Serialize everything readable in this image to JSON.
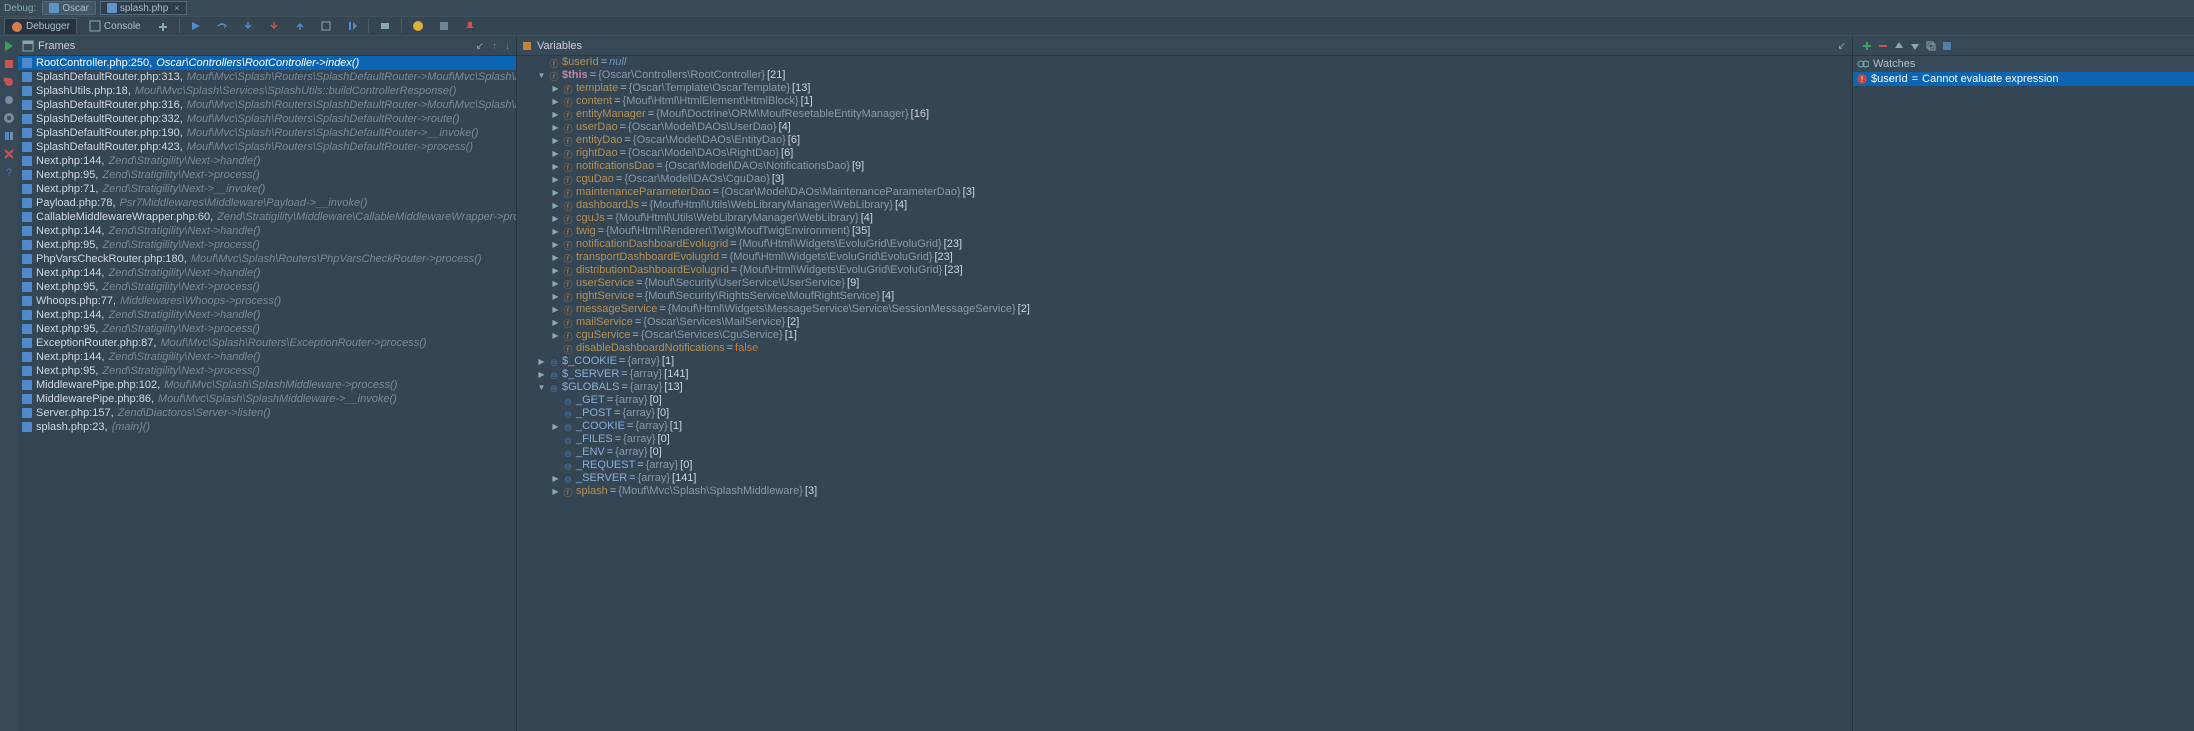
{
  "topbar": {
    "label": "Debug:",
    "tabs": [
      {
        "name": "Oscar",
        "active": false
      },
      {
        "name": "splash.php",
        "active": true
      }
    ]
  },
  "toolbar": {
    "debugger": "Debugger",
    "console": "Console"
  },
  "panels": {
    "frames": "Frames",
    "variables": "Variables",
    "watches": "Watches"
  },
  "frames": [
    {
      "loc": "RootController.php:250",
      "fn": "Oscar\\Controllers\\RootController->index()",
      "sel": true
    },
    {
      "loc": "SplashDefaultRouter.php:313",
      "fn": "Mouf\\Mvc\\Splash\\Routers\\SplashDefaultRouter->Mouf\\Mvc\\Splash\\Routers\\{closure:/var/www/...}"
    },
    {
      "loc": "SplashUtils.php:18",
      "fn": "Mouf\\Mvc\\Splash\\Services\\SplashUtils::buildControllerResponse()"
    },
    {
      "loc": "SplashDefaultRouter.php:316",
      "fn": "Mouf\\Mvc\\Splash\\Routers\\SplashDefaultRouter->Mouf\\Mvc\\Splash\\Routers\\{closure:/var/www/...}()"
    },
    {
      "loc": "SplashDefaultRouter.php:332",
      "fn": "Mouf\\Mvc\\Splash\\Routers\\SplashDefaultRouter->route()"
    },
    {
      "loc": "SplashDefaultRouter.php:190",
      "fn": "Mouf\\Mvc\\Splash\\Routers\\SplashDefaultRouter->__invoke()"
    },
    {
      "loc": "SplashDefaultRouter.php:423",
      "fn": "Mouf\\Mvc\\Splash\\Routers\\SplashDefaultRouter->process()"
    },
    {
      "loc": "Next.php:144",
      "fn": "Zend\\Stratigility\\Next->handle()"
    },
    {
      "loc": "Next.php:95",
      "fn": "Zend\\Stratigility\\Next->process()"
    },
    {
      "loc": "Next.php:71",
      "fn": "Zend\\Stratigility\\Next->__invoke()"
    },
    {
      "loc": "Payload.php:78",
      "fn": "Psr7Middlewares\\Middleware\\Payload->__invoke()"
    },
    {
      "loc": "CallableMiddlewareWrapper.php:60",
      "fn": "Zend\\Stratigility\\Middleware\\CallableMiddlewareWrapper->process()"
    },
    {
      "loc": "Next.php:144",
      "fn": "Zend\\Stratigility\\Next->handle()"
    },
    {
      "loc": "Next.php:95",
      "fn": "Zend\\Stratigility\\Next->process()"
    },
    {
      "loc": "PhpVarsCheckRouter.php:180",
      "fn": "Mouf\\Mvc\\Splash\\Routers\\PhpVarsCheckRouter->process()"
    },
    {
      "loc": "Next.php:144",
      "fn": "Zend\\Stratigility\\Next->handle()"
    },
    {
      "loc": "Next.php:95",
      "fn": "Zend\\Stratigility\\Next->process()"
    },
    {
      "loc": "Whoops.php:77",
      "fn": "Middlewares\\Whoops->process()"
    },
    {
      "loc": "Next.php:144",
      "fn": "Zend\\Stratigility\\Next->handle()"
    },
    {
      "loc": "Next.php:95",
      "fn": "Zend\\Stratigility\\Next->process()"
    },
    {
      "loc": "ExceptionRouter.php:87",
      "fn": "Mouf\\Mvc\\Splash\\Routers\\ExceptionRouter->process()"
    },
    {
      "loc": "Next.php:144",
      "fn": "Zend\\Stratigility\\Next->handle()"
    },
    {
      "loc": "Next.php:95",
      "fn": "Zend\\Stratigility\\Next->process()"
    },
    {
      "loc": "MiddlewarePipe.php:102",
      "fn": "Mouf\\Mvc\\Splash\\SplashMiddleware->process()"
    },
    {
      "loc": "MiddlewarePipe.php:86",
      "fn": "Mouf\\Mvc\\Splash\\SplashMiddleware->__invoke()"
    },
    {
      "loc": "Server.php:157",
      "fn": "Zend\\Diactoros\\Server->listen()"
    },
    {
      "loc": "splash.php:23",
      "fn": "{main}()"
    }
  ],
  "vars": [
    {
      "d": 0,
      "tw": "",
      "ico": "f",
      "name": "$userId",
      "eq": "=",
      "type": "",
      "val": "null",
      "valcls": "vlit",
      "ncls": "vname"
    },
    {
      "d": 0,
      "tw": "▼",
      "ico": "f",
      "name": "$this",
      "eq": "=",
      "type": "{Oscar\\Controllers\\RootController}",
      "val": "[21]",
      "ncls": "vnamebold"
    },
    {
      "d": 1,
      "tw": "▶",
      "ico": "f",
      "name": "template",
      "eq": "=",
      "type": "{Oscar\\Template\\OscarTemplate}",
      "val": "[13]",
      "ncls": "vname"
    },
    {
      "d": 1,
      "tw": "▶",
      "ico": "f",
      "name": "content",
      "eq": "=",
      "type": "{Mouf\\Html\\HtmlElement\\HtmlBlock}",
      "val": "[1]",
      "ncls": "vname"
    },
    {
      "d": 1,
      "tw": "▶",
      "ico": "f",
      "name": "entityManager",
      "eq": "=",
      "type": "{Mouf\\Doctrine\\ORM\\MoufResetableEntityManager}",
      "val": "[16]",
      "ncls": "vname"
    },
    {
      "d": 1,
      "tw": "▶",
      "ico": "f",
      "name": "userDao",
      "eq": "=",
      "type": "{Oscar\\Model\\DAOs\\UserDao}",
      "val": "[4]",
      "ncls": "vname"
    },
    {
      "d": 1,
      "tw": "▶",
      "ico": "f",
      "name": "entityDao",
      "eq": "=",
      "type": "{Oscar\\Model\\DAOs\\EntityDao}",
      "val": "[6]",
      "ncls": "vname"
    },
    {
      "d": 1,
      "tw": "▶",
      "ico": "f",
      "name": "rightDao",
      "eq": "=",
      "type": "{Oscar\\Model\\DAOs\\RightDao}",
      "val": "[6]",
      "ncls": "vname"
    },
    {
      "d": 1,
      "tw": "▶",
      "ico": "f",
      "name": "notificationsDao",
      "eq": "=",
      "type": "{Oscar\\Model\\DAOs\\NotificationsDao}",
      "val": "[9]",
      "ncls": "vname"
    },
    {
      "d": 1,
      "tw": "▶",
      "ico": "f",
      "name": "cguDao",
      "eq": "=",
      "type": "{Oscar\\Model\\DAOs\\CguDao}",
      "val": "[3]",
      "ncls": "vname"
    },
    {
      "d": 1,
      "tw": "▶",
      "ico": "f",
      "name": "maintenanceParameterDao",
      "eq": "=",
      "type": "{Oscar\\Model\\DAOs\\MaintenanceParameterDao}",
      "val": "[3]",
      "ncls": "vname"
    },
    {
      "d": 1,
      "tw": "▶",
      "ico": "f",
      "name": "dashboardJs",
      "eq": "=",
      "type": "{Mouf\\Html\\Utils\\WebLibraryManager\\WebLibrary}",
      "val": "[4]",
      "ncls": "vname"
    },
    {
      "d": 1,
      "tw": "▶",
      "ico": "f",
      "name": "cguJs",
      "eq": "=",
      "type": "{Mouf\\Html\\Utils\\WebLibraryManager\\WebLibrary}",
      "val": "[4]",
      "ncls": "vname"
    },
    {
      "d": 1,
      "tw": "▶",
      "ico": "f",
      "name": "twig",
      "eq": "=",
      "type": "{Mouf\\Html\\Renderer\\Twig\\MoufTwigEnvironment}",
      "val": "[35]",
      "ncls": "vname"
    },
    {
      "d": 1,
      "tw": "▶",
      "ico": "f",
      "name": "notificationDashboardEvolugrid",
      "eq": "=",
      "type": "{Mouf\\Html\\Widgets\\EvoluGrid\\EvoluGrid}",
      "val": "[23]",
      "ncls": "vname"
    },
    {
      "d": 1,
      "tw": "▶",
      "ico": "f",
      "name": "transportDashboardEvolugrid",
      "eq": "=",
      "type": "{Mouf\\Html\\Widgets\\EvoluGrid\\EvoluGrid}",
      "val": "[23]",
      "ncls": "vname"
    },
    {
      "d": 1,
      "tw": "▶",
      "ico": "f",
      "name": "distributionDashboardEvolugrid",
      "eq": "=",
      "type": "{Mouf\\Html\\Widgets\\EvoluGrid\\EvoluGrid}",
      "val": "[23]",
      "ncls": "vname"
    },
    {
      "d": 1,
      "tw": "▶",
      "ico": "f",
      "name": "userService",
      "eq": "=",
      "type": "{Mouf\\Security\\UserService\\UserService}",
      "val": "[9]",
      "ncls": "vname"
    },
    {
      "d": 1,
      "tw": "▶",
      "ico": "f",
      "name": "rightService",
      "eq": "=",
      "type": "{Mouf\\Security\\RightsService\\MoufRightService}",
      "val": "[4]",
      "ncls": "vname"
    },
    {
      "d": 1,
      "tw": "▶",
      "ico": "f",
      "name": "messageService",
      "eq": "=",
      "type": "{Mouf\\Html\\Widgets\\MessageService\\Service\\SessionMessageService}",
      "val": "[2]",
      "ncls": "vname"
    },
    {
      "d": 1,
      "tw": "▶",
      "ico": "f",
      "name": "mailService",
      "eq": "=",
      "type": "{Oscar\\Services\\MailService}",
      "val": "[2]",
      "ncls": "vname"
    },
    {
      "d": 1,
      "tw": "▶",
      "ico": "f",
      "name": "cguService",
      "eq": "=",
      "type": "{Oscar\\Services\\CguService}",
      "val": "[1]",
      "ncls": "vname"
    },
    {
      "d": 1,
      "tw": "",
      "ico": "f",
      "name": "disableDashboardNotifications",
      "eq": "=",
      "type": "",
      "val": "false",
      "valcls": "vfalse",
      "ncls": "vname"
    },
    {
      "d": 0,
      "tw": "▶",
      "ico": "g",
      "name": "$_COOKIE",
      "eq": "=",
      "type": "{array}",
      "val": "[1]",
      "ncls": "vname blue"
    },
    {
      "d": 0,
      "tw": "▶",
      "ico": "g",
      "name": "$_SERVER",
      "eq": "=",
      "type": "{array}",
      "val": "[141]",
      "ncls": "vname blue"
    },
    {
      "d": 0,
      "tw": "▼",
      "ico": "g",
      "name": "$GLOBALS",
      "eq": "=",
      "type": "{array}",
      "val": "[13]",
      "ncls": "vname blue"
    },
    {
      "d": 1,
      "tw": "",
      "ico": "g",
      "name": "_GET",
      "eq": "=",
      "type": "{array}",
      "val": "[0]",
      "ncls": "vname blue"
    },
    {
      "d": 1,
      "tw": "",
      "ico": "g",
      "name": "_POST",
      "eq": "=",
      "type": "{array}",
      "val": "[0]",
      "ncls": "vname blue"
    },
    {
      "d": 1,
      "tw": "▶",
      "ico": "g",
      "name": "_COOKIE",
      "eq": "=",
      "type": "{array}",
      "val": "[1]",
      "ncls": "vname blue"
    },
    {
      "d": 1,
      "tw": "",
      "ico": "g",
      "name": "_FILES",
      "eq": "=",
      "type": "{array}",
      "val": "[0]",
      "ncls": "vname blue"
    },
    {
      "d": 1,
      "tw": "",
      "ico": "g",
      "name": "_ENV",
      "eq": "=",
      "type": "{array}",
      "val": "[0]",
      "ncls": "vname blue"
    },
    {
      "d": 1,
      "tw": "",
      "ico": "g",
      "name": "_REQUEST",
      "eq": "=",
      "type": "{array}",
      "val": "[0]",
      "ncls": "vname blue"
    },
    {
      "d": 1,
      "tw": "▶",
      "ico": "g",
      "name": "_SERVER",
      "eq": "=",
      "type": "{array}",
      "val": "[141]",
      "ncls": "vname blue"
    },
    {
      "d": 1,
      "tw": "▶",
      "ico": "f",
      "name": "splash",
      "eq": "=",
      "type": "{Mouf\\Mvc\\Splash\\SplashMiddleware}",
      "val": "[3]",
      "ncls": "vname"
    }
  ],
  "watches": [
    {
      "name": "$userId",
      "eq": "=",
      "msg": "Cannot evaluate expression",
      "sel": true
    }
  ]
}
